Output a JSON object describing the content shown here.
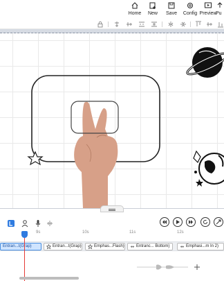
{
  "toolbar": {
    "home_label": "Home",
    "new_label": "New",
    "save_label": "Save",
    "config_label": "Config",
    "preview_label": "Preview",
    "publish_label": "Pu"
  },
  "timeline": {
    "ticks": [
      "9s",
      "10s",
      "11s",
      "12s"
    ],
    "clips": [
      {
        "label": "Entran...t(Grap)",
        "selected": true
      },
      {
        "label": "Entran...t(Grap)",
        "selected": false
      },
      {
        "label": "Emphas...Flash)",
        "selected": false
      },
      {
        "label": "Entranc... Bottom)",
        "selected": false
      },
      {
        "label": "Emphasi...m In 2)",
        "selected": false
      }
    ]
  },
  "colors": {
    "accent": "#2f7be0",
    "playhead": "#e53935",
    "selected_clip": "#cfe4ff"
  },
  "icons": {
    "top": [
      "home-icon",
      "new-icon",
      "save-icon",
      "config-icon",
      "preview-icon",
      "publish-icon"
    ],
    "align": [
      "lock-icon",
      "align-left-icon",
      "align-center-icon",
      "align-right-icon",
      "distribute-icon",
      "flip-horizontal-icon",
      "flip-vertical-icon",
      "align-top-icon",
      "align-middle-icon",
      "align-bottom-icon"
    ],
    "timeline": [
      "track-icon",
      "person-icon",
      "microphone-icon",
      "audio-icon"
    ],
    "playback": [
      "rewind-icon",
      "play-icon",
      "forward-icon",
      "loop-icon",
      "zoom-icon"
    ]
  }
}
